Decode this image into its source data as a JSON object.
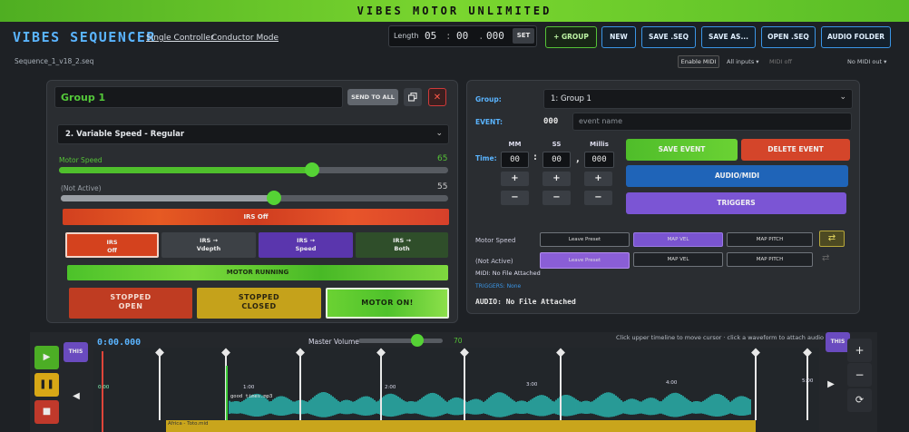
{
  "topbar": {
    "title": "VIBES MOTOR UNLIMITED"
  },
  "header": {
    "app_title": "VIBES SEQUENCER",
    "link_single": "Single Controller",
    "link_conductor": "Conductor Mode",
    "filename": "Sequence_1_v18_2.seq",
    "length_label": "Length",
    "length_mm": "05",
    "length_ss": "00",
    "length_ms": "000",
    "set_label": "SET",
    "buttons": {
      "add_group": "+ GROUP",
      "new": "NEW",
      "save_seq": "SAVE .SEQ",
      "save_as": "SAVE AS...",
      "open_seq": "OPEN .SEQ",
      "audio_folder": "AUDIO FOLDER"
    },
    "enable_midi": "Enable MIDI",
    "all_inputs": "All inputs",
    "midi_off": "MIDI off",
    "no_midi_out": "No MIDI out"
  },
  "group_panel": {
    "name": "Group 1",
    "send_to_all": "SEND TO ALL",
    "mode_select": "2. Variable Speed - Regular",
    "motor_speed_label": "Motor Speed",
    "motor_speed_value": "65",
    "motor_speed_fraction": 0.65,
    "second_label": "(Not Active)",
    "second_value": "55",
    "second_fraction": 0.55,
    "irs_bar": "IRS Off",
    "modes": [
      {
        "line1": "IRS",
        "line2": "Off"
      },
      {
        "line1": "IRS →",
        "line2": "Vdepth"
      },
      {
        "line1": "IRS →",
        "line2": "Speed"
      },
      {
        "line1": "IRS →",
        "line2": "Both"
      }
    ],
    "motor_running": "MOTOR RUNNING",
    "stopped_open": {
      "line1": "STOPPED",
      "line2": "OPEN"
    },
    "stopped_closed": {
      "line1": "STOPPED",
      "line2": "CLOSED"
    },
    "motor_on": "MOTOR ON!"
  },
  "event_panel": {
    "group_label": "Group:",
    "group_value": "1: Group 1",
    "event_label": "EVENT:",
    "event_number": "000",
    "event_name_placeholder": "event name",
    "time_label": "Time:",
    "mm_label": "MM",
    "ss_label": "SS",
    "millis_label": "Millis",
    "mm": "00",
    "ss": "00",
    "millis": "000",
    "plus": "+",
    "minus": "−",
    "save_event": "SAVE EVENT",
    "delete_event": "DELETE EVENT",
    "audio_midi": "AUDIO/MIDI",
    "triggers": "TRIGGERS",
    "motor_speed_label": "Motor Speed",
    "not_active_label": "(Not Active)",
    "leave_preset": "Leave Preset",
    "map_vel": "MAP VEL",
    "map_pitch": "MAP PITCH",
    "midi_status": "MIDI: No File Attached",
    "triggers_status": "TRIGGERS: None",
    "audio_status": "AUDIO: No File Attached"
  },
  "timeline": {
    "time_display": "0:00.000",
    "master_volume_label": "Master Volume",
    "master_volume_value": "70",
    "master_volume_fraction": 0.7,
    "hint": "Click upper timeline to move cursor · click a waveform to attach audio",
    "this_label": "THIS",
    "tick_labels": [
      "0:00",
      "1:00",
      "2:00",
      "3:00",
      "4:00",
      "5:00"
    ],
    "track_name": "good times.mp3",
    "midi_track": "Africa - Toto.mid"
  },
  "colors": {
    "accent_blue": "#3a95e6",
    "accent_green": "#55c237",
    "red": "#d8462a",
    "purple": "#6a3fb8"
  }
}
